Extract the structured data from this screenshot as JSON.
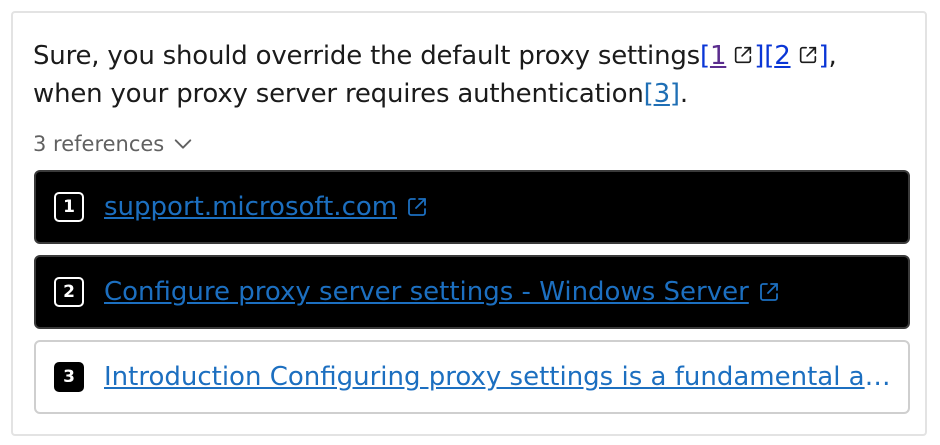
{
  "answer": {
    "text_before": "Sure, you should override the default proxy settings",
    "text_middle": ", when your proxy server requires authentication",
    "text_end": ".",
    "citations": [
      {
        "label": "1"
      },
      {
        "label": "2"
      },
      {
        "label": "3"
      }
    ]
  },
  "references": {
    "toggle_label": "3 references",
    "items": [
      {
        "number": "1",
        "title": "support.microsoft.com",
        "external": true,
        "style": "dark"
      },
      {
        "number": "2",
        "title": "Configure proxy server settings - Windows Server",
        "external": true,
        "style": "dark"
      },
      {
        "number": "3",
        "title": "Introduction Configuring proxy settings is a fundamental as…",
        "external": false,
        "style": "light"
      }
    ]
  },
  "colors": {
    "link": "#1c6fc0",
    "visited_citation": "#5b2d8e",
    "citation": "#0a36d6"
  },
  "icons": {
    "external": "external-link-icon",
    "toggle": "chevron-down-icon"
  }
}
